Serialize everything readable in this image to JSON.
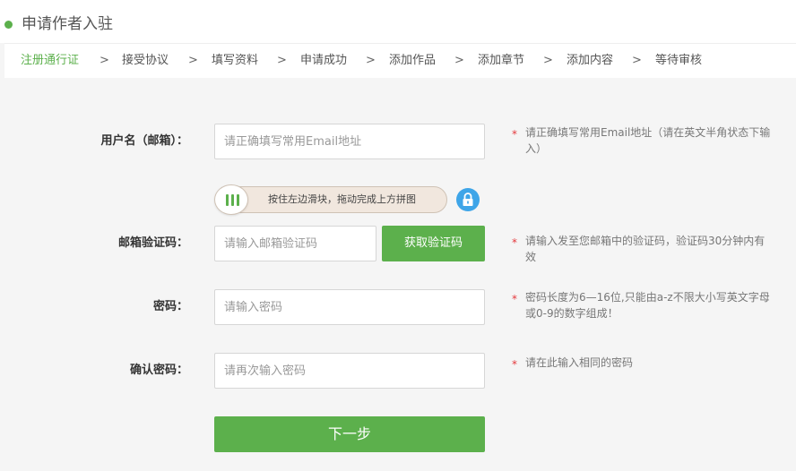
{
  "header": {
    "title": "申请作者入驻",
    "accent_color": "#5cb04c"
  },
  "steps": [
    {
      "label": "注册通行证",
      "active": true
    },
    {
      "label": "接受协议",
      "active": false
    },
    {
      "label": "填写资料",
      "active": false
    },
    {
      "label": "申请成功",
      "active": false
    },
    {
      "label": "添加作品",
      "active": false
    },
    {
      "label": "添加章节",
      "active": false
    },
    {
      "label": "添加内容",
      "active": false
    },
    {
      "label": "等待审核",
      "active": false
    }
  ],
  "step_separator": ">",
  "form": {
    "username": {
      "label": "用户名（邮箱）：",
      "placeholder": "请正确填写常用Email地址",
      "value": "",
      "hint": "请正确填写常用Email地址（请在英文半角状态下输入）"
    },
    "slider": {
      "text": "按住左边滑块，拖动完成上方拼图",
      "handle_icon": "grip-icon",
      "lock_icon": "lock-icon",
      "lock_color": "#3ea5e8"
    },
    "email_code": {
      "label": "邮箱验证码：",
      "placeholder": "请输入邮箱验证码",
      "value": "",
      "button_label": "获取验证码",
      "hint": "请输入发至您邮箱中的验证码，验证码30分钟内有效"
    },
    "password": {
      "label": "密码：",
      "placeholder": "请输入密码",
      "value": "",
      "hint": "密码长度为6—16位,只能由a-z不限大小写英文字母或0-9的数字组成！"
    },
    "confirm_password": {
      "label": "确认密码：",
      "placeholder": "请再次输入密码",
      "value": "",
      "hint": "请在此输入相同的密码"
    },
    "required_mark": "*",
    "next_button_label": "下一步"
  }
}
